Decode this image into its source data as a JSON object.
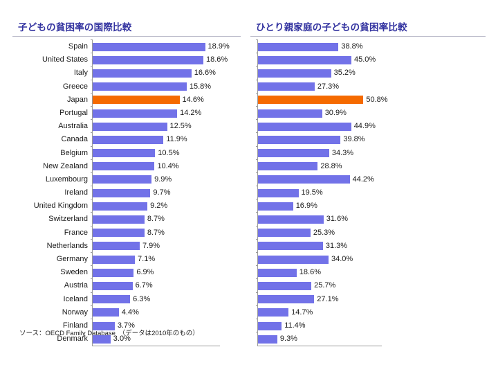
{
  "slide": {
    "source_note": "ソース：OECD Family Database　（データは2010年のもの）"
  },
  "left_panel": {
    "title": "子どもの貧困率の国際比較"
  },
  "right_panel": {
    "title": "ひとり親家庭の子どもの貧困率比較"
  },
  "colors": {
    "bar": "#7272e8",
    "bar_highlight": "#f56a00",
    "title_text": "#3333a0",
    "axis": "#9a9a9a",
    "background": "#ffffff"
  },
  "chart_data": [
    {
      "type": "bar",
      "title": "子どもの貧困率の国際比較",
      "orientation": "horizontal",
      "xlabel": "",
      "ylabel": "",
      "xlim": [
        0,
        20
      ],
      "grid": false,
      "legend": "none",
      "highlight_category": "Japan",
      "categories": [
        "Spain",
        "United States",
        "Italy",
        "Greece",
        "Japan",
        "Portugal",
        "Australia",
        "Canada",
        "Belgium",
        "New Zealand",
        "Luxembourg",
        "Ireland",
        "United Kingdom",
        "Switzerland",
        "France",
        "Netherlands",
        "Germany",
        "Sweden",
        "Austria",
        "Iceland",
        "Norway",
        "Finland",
        "Denmark"
      ],
      "values": [
        18.9,
        18.6,
        16.6,
        15.8,
        14.6,
        14.2,
        12.5,
        11.9,
        10.5,
        10.4,
        9.9,
        9.7,
        9.2,
        8.7,
        8.7,
        7.9,
        7.1,
        6.9,
        6.7,
        6.3,
        4.4,
        3.7,
        3.0
      ],
      "data_labels": [
        "18.9%",
        "18.6%",
        "16.6%",
        "15.8%",
        "14.6%",
        "14.2%",
        "12.5%",
        "11.9%",
        "10.5%",
        "10.4%",
        "9.9%",
        "9.7%",
        "9.2%",
        "8.7%",
        "8.7%",
        "7.9%",
        "7.1%",
        "6.9%",
        "6.7%",
        "6.3%",
        "4.4%",
        "3.7%",
        "3.0%"
      ]
    },
    {
      "type": "bar",
      "title": "ひとり親家庭の子どもの貧困率比較",
      "orientation": "horizontal",
      "xlabel": "",
      "ylabel": "",
      "xlim": [
        0,
        60
      ],
      "grid": false,
      "legend": "none",
      "highlight_category": "Japan",
      "categories": [
        "Spain",
        "United States",
        "Italy",
        "Greece",
        "Japan",
        "Portugal",
        "Australia",
        "Canada",
        "Belgium",
        "New Zealand",
        "Luxembourg",
        "Ireland",
        "United Kingdom",
        "Switzerland",
        "France",
        "Netherlands",
        "Germany",
        "Sweden",
        "Austria",
        "Iceland",
        "Norway",
        "Finland",
        "Denmark"
      ],
      "values": [
        38.8,
        45.0,
        35.2,
        27.3,
        50.8,
        30.9,
        44.9,
        39.8,
        34.3,
        28.8,
        44.2,
        19.5,
        16.9,
        31.6,
        25.3,
        31.3,
        34.0,
        18.6,
        25.7,
        27.1,
        14.7,
        11.4,
        9.3
      ],
      "data_labels": [
        "38.8%",
        "45.0%",
        "35.2%",
        "27.3%",
        "50.8%",
        "30.9%",
        "44.9%",
        "39.8%",
        "34.3%",
        "28.8%",
        "44.2%",
        "19.5%",
        "16.9%",
        "31.6%",
        "25.3%",
        "31.3%",
        "34.0%",
        "18.6%",
        "25.7%",
        "27.1%",
        "14.7%",
        "11.4%",
        "9.3%"
      ]
    }
  ]
}
